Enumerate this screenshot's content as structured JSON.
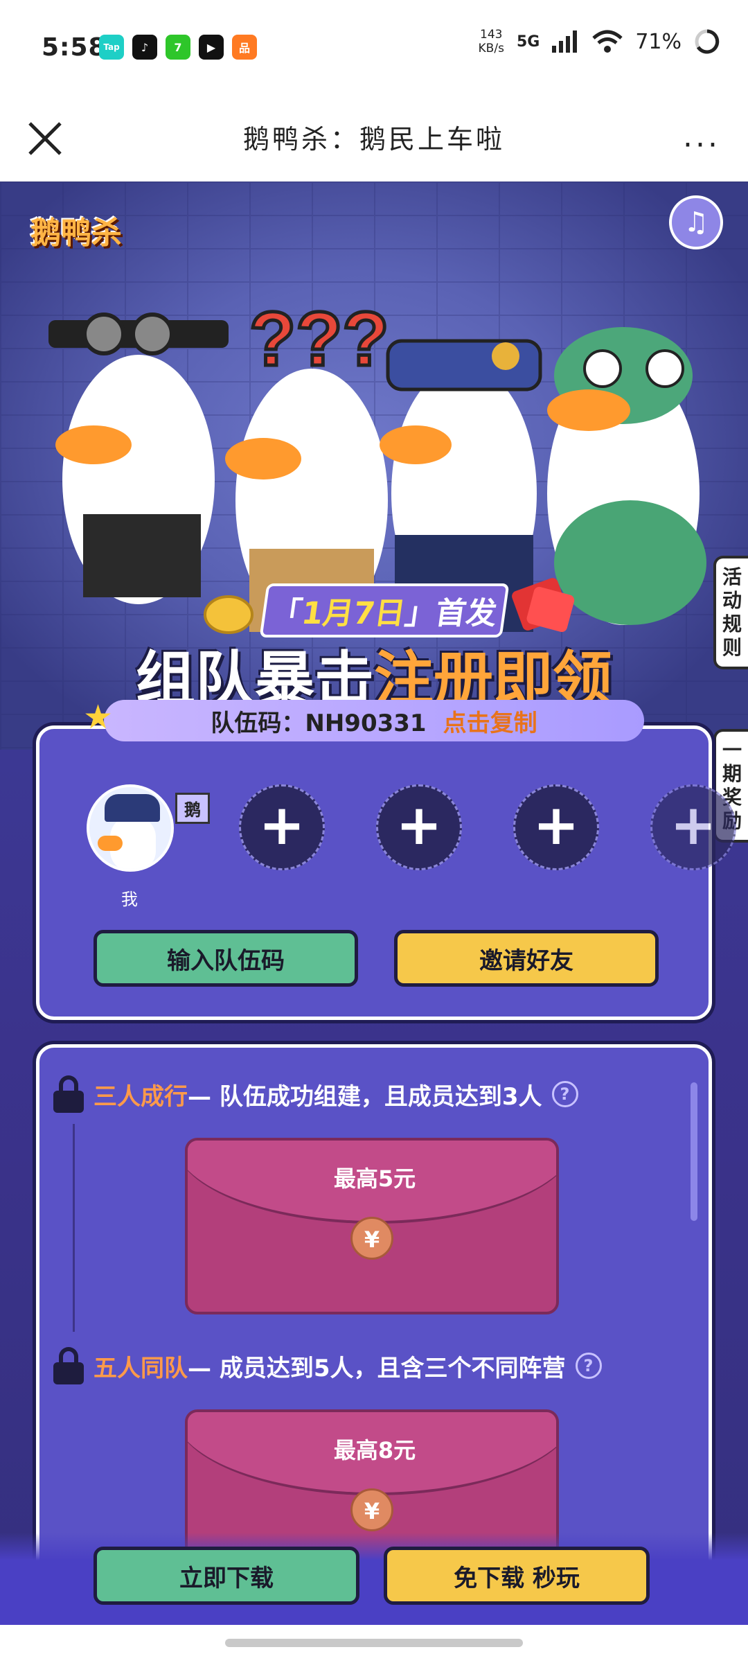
{
  "status_bar": {
    "time": "5:58",
    "app_icons": [
      {
        "name": "taptap-icon",
        "label": "Tap",
        "color": "#1ecfc6"
      },
      {
        "name": "tiktok-icon",
        "label": "♪",
        "color": "#111111"
      },
      {
        "name": "app7-icon",
        "label": "7",
        "color": "#2ec62a"
      },
      {
        "name": "video-icon",
        "label": "▶",
        "color": "#111111"
      },
      {
        "name": "app-orange-icon",
        "label": "品",
        "color": "#ff7a22"
      }
    ],
    "speed_value": "143",
    "speed_unit": "KB/s",
    "network": "5G",
    "battery": "71%"
  },
  "titlebar": {
    "title": "鹅鸭杀：鹅民上车啦",
    "more": "···"
  },
  "hero": {
    "logo": "鹅鸭杀",
    "side_rules": "活动规则",
    "side_rewards": "一期奖励",
    "date_prefix": "「",
    "date": "1月7日",
    "date_suffix": "」首发",
    "title_white": "组队暴击",
    "title_orange": "注册即领",
    "team_code_label": "队伍码：",
    "team_code": "NH90331",
    "copy_label": "点击复制"
  },
  "team": {
    "me_tag": "鹅",
    "me_label": "我",
    "add_symbol": "+",
    "enter_code_btn": "输入队伍码",
    "invite_btn": "邀请好友"
  },
  "rewards": [
    {
      "name": "三人成行",
      "desc": "— 队伍成功组建，且成员达到3人",
      "amount": "最高5元",
      "coin": "¥"
    },
    {
      "name": "五人同队",
      "desc": "— 成员达到5人，且含三个不同阵营",
      "amount": "最高8元",
      "coin": "¥"
    }
  ],
  "bottom": {
    "download_btn": "立即下载",
    "play_btn": "免下载 秒玩"
  }
}
